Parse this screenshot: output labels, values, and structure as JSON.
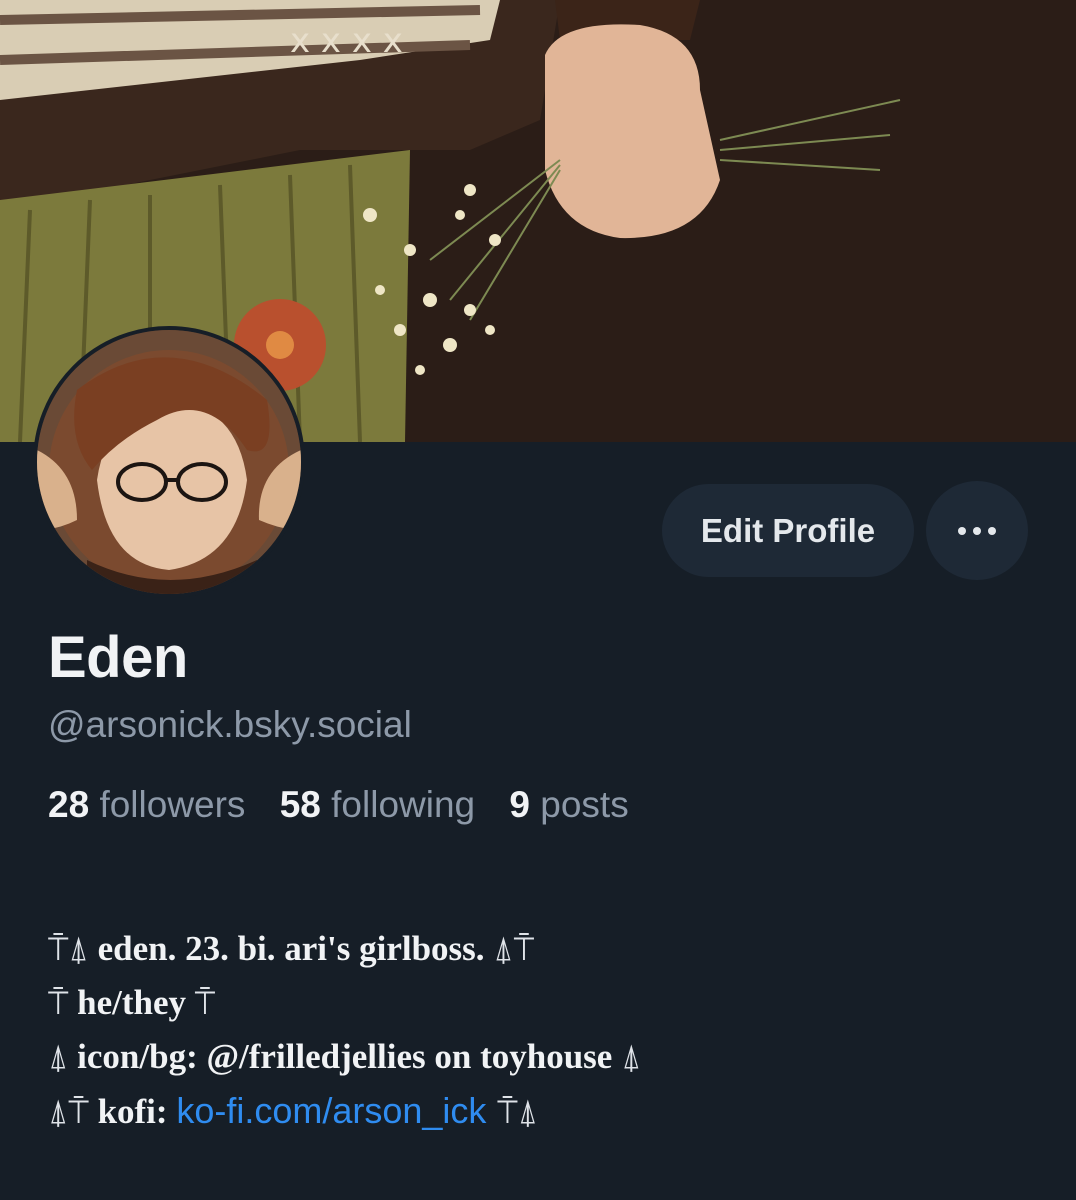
{
  "profile": {
    "display_name": "Eden",
    "handle": "@arsonick.bsky.social",
    "edit_button_label": "Edit Profile",
    "more_icon": "ellipsis-icon"
  },
  "stats": [
    {
      "value": "28",
      "label": "followers"
    },
    {
      "value": "58",
      "label": "following"
    },
    {
      "value": "9",
      "label": "posts"
    }
  ],
  "bio": {
    "line1": {
      "prefix": "⍑⍋",
      "text": " eden. 23. bi. ari's girlboss. ",
      "suffix": "⍋⍑"
    },
    "line2": {
      "prefix": "⍑",
      "text": " he/they ",
      "suffix": "⍑"
    },
    "line3": {
      "prefix": "⍋",
      "text": " icon/bg: @/frilledjellies on toyhouse ",
      "suffix": "⍋"
    },
    "line4": {
      "prefix": "⍋⍑",
      "text": " kofi: ",
      "link": "ko-fi.com/arson_ick",
      "suffix": " ⍑⍋"
    }
  },
  "colors": {
    "background": "#161e27",
    "button_bg": "#1e2936",
    "muted_text": "#8d99a8",
    "link": "#2f8cf0"
  }
}
